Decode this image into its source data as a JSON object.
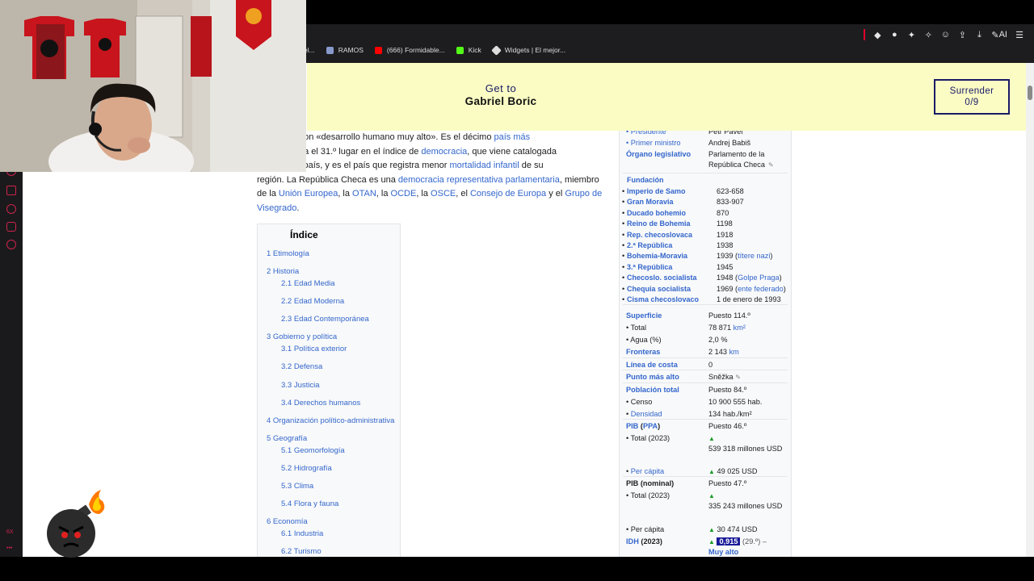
{
  "browser": {
    "bookmarks": [
      {
        "label": "el...",
        "color": "#777777"
      },
      {
        "label": "RAMOS",
        "color": "#8899cc"
      },
      {
        "label": "(666) Formidable...",
        "color": "#ff0000"
      },
      {
        "label": "Kick",
        "color": "#53fc18"
      },
      {
        "label": "Widgets | El mejor...",
        "color": "#dddddd"
      }
    ],
    "toolbar_ai_label": "AI"
  },
  "sidebar": {
    "bottom_label": "6X"
  },
  "game": {
    "goal_prefix": "Get to",
    "goal_target": "Gabriel Boric",
    "surrender_label": "Surrender",
    "surrender_count": "0/9"
  },
  "article": {
    "p1_a": "un Estado con «desarrollo humano muy alto». Es el décimo ",
    "p1_link1": "país más",
    "p2_a": "uropa, ocupa el 31.º lugar en el índice de ",
    "p2_link": "democracia",
    "p2_b": ", que viene catalogada",
    "p3_a": "ente» en el país, y es el país que registra menor ",
    "p3_link": "mortalidad infantil",
    "p3_b": " de su",
    "p4_a": "región. La República Checa es una ",
    "p4_link": "democracia representativa parlamentaria",
    "p4_b": ", miembro",
    "p5_a": "de la ",
    "p5_l1": "Unión Europea",
    "p5_b": ", la ",
    "p5_l2": "OTAN",
    "p5_c": ", la ",
    "p5_l3": "OCDE",
    "p5_d": ", la ",
    "p5_l4": "OSCE",
    "p5_e": ", el ",
    "p5_l5": "Consejo de Europa",
    "p5_f": " y el ",
    "p5_l6": "Grupo de",
    "p6_l6b": "Visegrado",
    "p6_end": "."
  },
  "toc": {
    "title": "Índice",
    "items": [
      "1 Etimología",
      "2 Historia",
      "2.1 Edad Media",
      "2.2 Edad Moderna",
      "2.3 Edad Contemporánea",
      "3 Gobierno y política",
      "3.1 Política exterior",
      "3.2 Defensa",
      "3.3 Justicia",
      "3.4 Derechos humanos",
      "4 Organización político-administrativa",
      "5 Geografía",
      "5.1 Geomorfología",
      "5.2 Hidrografía",
      "5.3 Clima",
      "5.4 Flora y fauna",
      "6 Economía",
      "6.1 Industria",
      "6.2 Turismo"
    ]
  },
  "infobox": {
    "presidente_k": "• Presidente",
    "presidente_v": "Petr Pavel",
    "pm_k": "• Primer ministro",
    "pm_v": "Andrej Babiš",
    "leg_k": "Órgano legislativo",
    "leg_v": "Parlamento de la República Checa",
    "fundacion": "Fundación",
    "fund_rows": [
      {
        "k": "Imperio de Samo",
        "v": "623-658"
      },
      {
        "k": "Gran Moravia",
        "v": "833-907"
      },
      {
        "k": "Ducado bohemio",
        "v": "870"
      },
      {
        "k": "Reino de Bohemia",
        "v": "1198"
      },
      {
        "k": "Rep. checoslovaca",
        "v": "1918"
      },
      {
        "k": "2.ª República",
        "v": "1938"
      },
      {
        "k": "Bohemia-Moravia",
        "v": "1939 (",
        "link": "títere nazi",
        "end": ")"
      },
      {
        "k": "3.ª República",
        "v": "1945"
      },
      {
        "k": "Checoslo. socialista",
        "v": "1948 (",
        "link": "Golpe Praga",
        "end": ")"
      },
      {
        "k": "Chequia socialista",
        "v": "1969 (",
        "link": "ente federado",
        "end": ")"
      },
      {
        "k": "Cisma checoslovaco",
        "v": "1 de enero de 1993"
      }
    ],
    "superficie_k": "Superficie",
    "superficie_v": "Puesto 114.º",
    "total_k": "• Total",
    "total_v": "78 871",
    "total_unit": "km²",
    "agua_k": "• Agua (%)",
    "agua_v": "2,0 %",
    "fronteras_k": "Fronteras",
    "fronteras_v": "2 143",
    "fronteras_unit": "km",
    "costa_k": "Línea de costa",
    "costa_v": "0",
    "punto_k": "Punto más alto",
    "punto_v": "Sněžka",
    "pob_k": "Población total",
    "pob_v": "Puesto 84.º",
    "censo_k": "• Censo",
    "censo_v": "10 900 555  hab.",
    "dens_k": "Densidad",
    "dens_v": "134 hab./km²",
    "pib_k": "PIB",
    "pib_ppa": "PPA",
    "pib_v": "Puesto 46.º",
    "pib_total_k": "• Total (2023)",
    "pib_total_v": "539 318 millones USD",
    "pib_pc_k": "Per cápita",
    "pib_pc_v": "49 025 USD",
    "pibn_k": "PIB (nominal)",
    "pibn_v": "Puesto 47.º",
    "pibn_total_k": "• Total (2023)",
    "pibn_total_v": "335 243 millones USD",
    "pibn_pc_k": "• Per cápita",
    "pibn_pc_v": "30 474 USD",
    "idh_k": "IDH",
    "idh_year": "(2023)",
    "idh_v": "0,915",
    "idh_rank": "(29.º) –",
    "idh_cat": "Muy alto"
  }
}
